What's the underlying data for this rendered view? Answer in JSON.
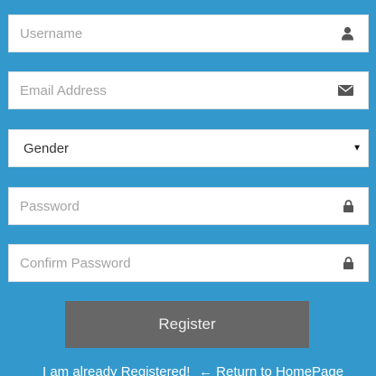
{
  "form": {
    "username": {
      "placeholder": "Username",
      "value": "",
      "icon": "user-icon"
    },
    "email": {
      "placeholder": "Email Address",
      "value": "",
      "icon": "envelope-icon"
    },
    "gender": {
      "selected": "Gender",
      "caret": "▼",
      "options": [
        "Gender"
      ]
    },
    "password": {
      "placeholder": "Password",
      "value": "",
      "icon": "lock-icon"
    },
    "confirm_password": {
      "placeholder": "Confirm Password",
      "value": "",
      "icon": "lock-icon"
    },
    "register_label": "Register"
  },
  "links": {
    "already_registered": "I am already Registered!",
    "return_home_arrow": "←",
    "return_home": "Return to HomePage"
  },
  "colors": {
    "background": "#3399cc",
    "button": "#676767",
    "input_bg": "#ffffff",
    "placeholder": "#a3a3a3",
    "icon": "#555555"
  }
}
